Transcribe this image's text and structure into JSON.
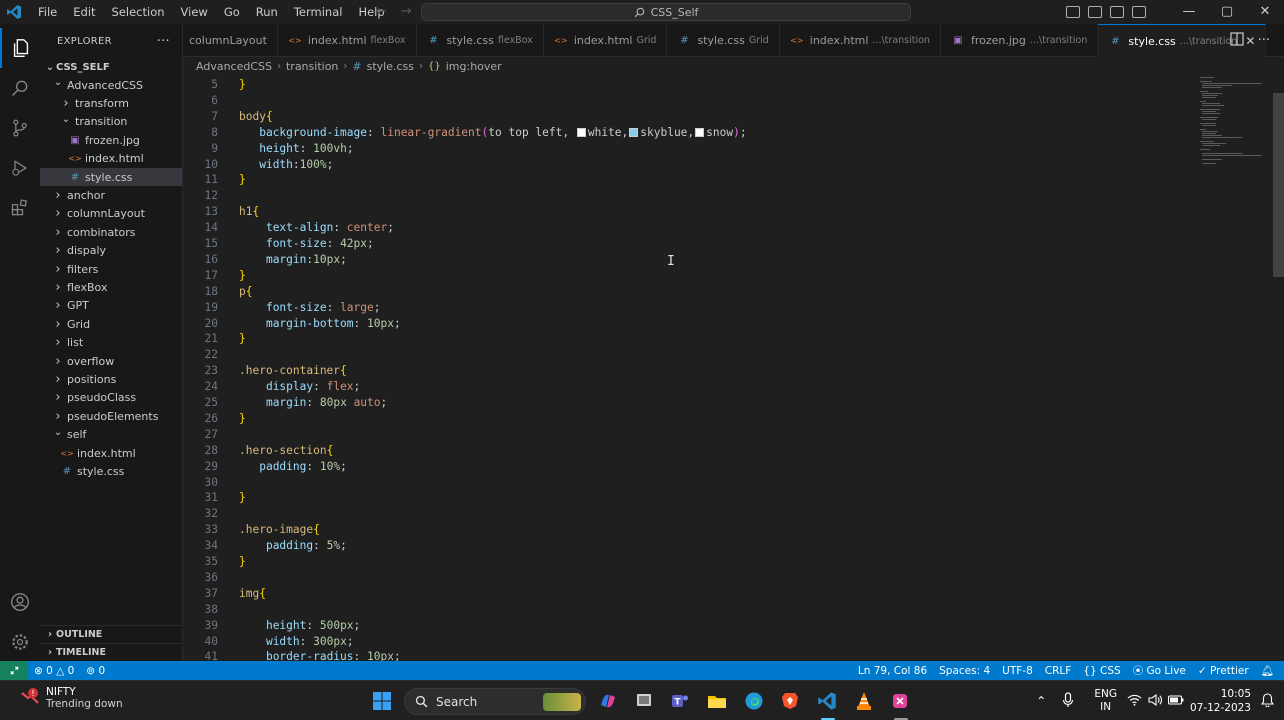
{
  "titlebar": {
    "menu": [
      "File",
      "Edit",
      "Selection",
      "View",
      "Go",
      "Run",
      "Terminal",
      "Help"
    ],
    "search_text": "CSS_Self",
    "minimize": "—",
    "maximize": "▢",
    "close": "✕"
  },
  "sidebar": {
    "header": "EXPLORER",
    "more": "···",
    "root": "CSS_SELF",
    "items": [
      {
        "label": "AdvancedCSS",
        "type": "folder-open",
        "indent": 1
      },
      {
        "label": "transform",
        "type": "folder",
        "indent": 2
      },
      {
        "label": "transition",
        "type": "folder-open",
        "indent": 2
      },
      {
        "label": "frozen.jpg",
        "type": "image",
        "indent": 3
      },
      {
        "label": "index.html",
        "type": "html",
        "indent": 3
      },
      {
        "label": "style.css",
        "type": "css",
        "indent": 3,
        "selected": true
      },
      {
        "label": "anchor",
        "type": "folder",
        "indent": 1
      },
      {
        "label": "columnLayout",
        "type": "folder",
        "indent": 1
      },
      {
        "label": "combinators",
        "type": "folder",
        "indent": 1
      },
      {
        "label": "dispaly",
        "type": "folder",
        "indent": 1
      },
      {
        "label": "filters",
        "type": "folder",
        "indent": 1
      },
      {
        "label": "flexBox",
        "type": "folder",
        "indent": 1
      },
      {
        "label": "GPT",
        "type": "folder",
        "indent": 1
      },
      {
        "label": "Grid",
        "type": "folder",
        "indent": 1
      },
      {
        "label": "list",
        "type": "folder",
        "indent": 1
      },
      {
        "label": "overflow",
        "type": "folder",
        "indent": 1
      },
      {
        "label": "positions",
        "type": "folder",
        "indent": 1
      },
      {
        "label": "pseudoClass",
        "type": "folder",
        "indent": 1
      },
      {
        "label": "pseudoElements",
        "type": "folder",
        "indent": 1
      },
      {
        "label": "self",
        "type": "folder-open",
        "indent": 1
      },
      {
        "label": "index.html",
        "type": "html",
        "indent": 2
      },
      {
        "label": "style.css",
        "type": "css",
        "indent": 2
      }
    ],
    "outline": "OUTLINE",
    "timeline": "TIMELINE"
  },
  "tabs": [
    {
      "label": "columnLayout",
      "desc": "",
      "type": "css-partial",
      "active": false
    },
    {
      "label": "index.html",
      "desc": "flexBox",
      "type": "html",
      "active": false
    },
    {
      "label": "style.css",
      "desc": "flexBox",
      "type": "css",
      "active": false
    },
    {
      "label": "index.html",
      "desc": "Grid",
      "type": "html",
      "active": false
    },
    {
      "label": "style.css",
      "desc": "Grid",
      "type": "css",
      "active": false
    },
    {
      "label": "index.html",
      "desc": "...\\transition",
      "type": "html",
      "active": false
    },
    {
      "label": "frozen.jpg",
      "desc": "...\\transition",
      "type": "image",
      "active": false
    },
    {
      "label": "style.css",
      "desc": "...\\transition",
      "type": "css",
      "active": true
    }
  ],
  "breadcrumb": [
    "AdvancedCSS",
    "transition",
    "style.css",
    "img:hover"
  ],
  "editor": {
    "lines": [
      {
        "n": "5",
        "code": [
          [
            "br",
            "}"
          ]
        ]
      },
      {
        "n": "6",
        "code": []
      },
      {
        "n": "7",
        "code": [
          [
            "sel",
            "body"
          ],
          [
            "br",
            "{"
          ]
        ]
      },
      {
        "n": "8",
        "code": [
          [
            "t",
            "   "
          ],
          [
            "prop",
            "background-image"
          ],
          [
            "t",
            ": "
          ],
          [
            "val",
            "linear-gradient"
          ],
          [
            "br2",
            "("
          ],
          [
            "t",
            "to top left, "
          ],
          [
            "sw",
            "#ffffff"
          ],
          [
            "t",
            "white,"
          ],
          [
            "sw",
            "#87ceeb"
          ],
          [
            "t",
            "skyblue,"
          ],
          [
            "sw",
            "#fffafa"
          ],
          [
            "t",
            "snow"
          ],
          [
            "br2",
            ")"
          ],
          [
            "t",
            ";"
          ]
        ]
      },
      {
        "n": "9",
        "code": [
          [
            "t",
            "   "
          ],
          [
            "prop",
            "height"
          ],
          [
            "t",
            ": "
          ],
          [
            "num",
            "100vh"
          ],
          [
            "t",
            ";"
          ]
        ]
      },
      {
        "n": "10",
        "code": [
          [
            "t",
            "   "
          ],
          [
            "prop",
            "width"
          ],
          [
            "t",
            ":"
          ],
          [
            "num",
            "100%"
          ],
          [
            "t",
            ";"
          ]
        ]
      },
      {
        "n": "11",
        "code": [
          [
            "br",
            "}"
          ]
        ]
      },
      {
        "n": "12",
        "code": []
      },
      {
        "n": "13",
        "code": [
          [
            "sel",
            "h1"
          ],
          [
            "br",
            "{"
          ]
        ]
      },
      {
        "n": "14",
        "code": [
          [
            "t",
            "    "
          ],
          [
            "prop",
            "text-align"
          ],
          [
            "t",
            ": "
          ],
          [
            "val",
            "center"
          ],
          [
            "t",
            ";"
          ]
        ]
      },
      {
        "n": "15",
        "code": [
          [
            "t",
            "    "
          ],
          [
            "prop",
            "font-size"
          ],
          [
            "t",
            ": "
          ],
          [
            "num",
            "42px"
          ],
          [
            "t",
            ";"
          ]
        ]
      },
      {
        "n": "16",
        "code": [
          [
            "t",
            "    "
          ],
          [
            "prop",
            "margin"
          ],
          [
            "t",
            ":"
          ],
          [
            "num",
            "10px"
          ],
          [
            "t",
            ";"
          ]
        ]
      },
      {
        "n": "17",
        "code": [
          [
            "br",
            "}"
          ]
        ]
      },
      {
        "n": "18",
        "code": [
          [
            "sel",
            "p"
          ],
          [
            "br",
            "{"
          ]
        ]
      },
      {
        "n": "19",
        "code": [
          [
            "t",
            "    "
          ],
          [
            "prop",
            "font-size"
          ],
          [
            "t",
            ": "
          ],
          [
            "val",
            "large"
          ],
          [
            "t",
            ";"
          ]
        ]
      },
      {
        "n": "20",
        "code": [
          [
            "t",
            "    "
          ],
          [
            "prop",
            "margin-bottom"
          ],
          [
            "t",
            ": "
          ],
          [
            "num",
            "10px"
          ],
          [
            "t",
            ";"
          ]
        ]
      },
      {
        "n": "21",
        "code": [
          [
            "br",
            "}"
          ]
        ]
      },
      {
        "n": "22",
        "code": []
      },
      {
        "n": "23",
        "code": [
          [
            "sel",
            ".hero-container"
          ],
          [
            "br",
            "{"
          ]
        ]
      },
      {
        "n": "24",
        "code": [
          [
            "t",
            "    "
          ],
          [
            "prop",
            "display"
          ],
          [
            "t",
            ": "
          ],
          [
            "val",
            "flex"
          ],
          [
            "t",
            ";"
          ]
        ]
      },
      {
        "n": "25",
        "code": [
          [
            "t",
            "    "
          ],
          [
            "prop",
            "margin"
          ],
          [
            "t",
            ": "
          ],
          [
            "num",
            "80px"
          ],
          [
            "t",
            " "
          ],
          [
            "val",
            "auto"
          ],
          [
            "t",
            ";"
          ]
        ]
      },
      {
        "n": "26",
        "code": [
          [
            "br",
            "}"
          ]
        ]
      },
      {
        "n": "27",
        "code": []
      },
      {
        "n": "28",
        "code": [
          [
            "sel",
            ".hero-section"
          ],
          [
            "br",
            "{"
          ]
        ]
      },
      {
        "n": "29",
        "code": [
          [
            "t",
            "   "
          ],
          [
            "prop",
            "padding"
          ],
          [
            "t",
            ": "
          ],
          [
            "num",
            "10%"
          ],
          [
            "t",
            ";"
          ]
        ]
      },
      {
        "n": "30",
        "code": []
      },
      {
        "n": "31",
        "code": [
          [
            "br",
            "}"
          ]
        ]
      },
      {
        "n": "32",
        "code": []
      },
      {
        "n": "33",
        "code": [
          [
            "sel",
            ".hero-image"
          ],
          [
            "br",
            "{"
          ]
        ]
      },
      {
        "n": "34",
        "code": [
          [
            "t",
            "    "
          ],
          [
            "prop",
            "padding"
          ],
          [
            "t",
            ": "
          ],
          [
            "num",
            "5%"
          ],
          [
            "t",
            ";"
          ]
        ]
      },
      {
        "n": "35",
        "code": [
          [
            "br",
            "}"
          ]
        ]
      },
      {
        "n": "36",
        "code": []
      },
      {
        "n": "37",
        "code": [
          [
            "sel",
            "img"
          ],
          [
            "br",
            "{"
          ]
        ]
      },
      {
        "n": "38",
        "code": []
      },
      {
        "n": "39",
        "code": [
          [
            "t",
            "    "
          ],
          [
            "prop",
            "height"
          ],
          [
            "t",
            ": "
          ],
          [
            "num",
            "500px"
          ],
          [
            "t",
            ";"
          ]
        ]
      },
      {
        "n": "40",
        "code": [
          [
            "t",
            "    "
          ],
          [
            "prop",
            "width"
          ],
          [
            "t",
            ": "
          ],
          [
            "num",
            "300px"
          ],
          [
            "t",
            ";"
          ]
        ]
      },
      {
        "n": "41",
        "code": [
          [
            "t",
            "    "
          ],
          [
            "prop",
            "border-radius"
          ],
          [
            "t",
            ": "
          ],
          [
            "num",
            "10px"
          ],
          [
            "t",
            ";"
          ]
        ]
      }
    ]
  },
  "statusbar": {
    "errors": "0",
    "warnings": "0",
    "ports": "0",
    "position": "Ln 79, Col 86",
    "spaces": "Spaces: 4",
    "encoding": "UTF-8",
    "eol": "CRLF",
    "language": "CSS",
    "golive": "Go Live",
    "prettier": "Prettier"
  },
  "taskbar": {
    "weather_title": "NIFTY",
    "weather_sub": "Trending down",
    "badge": "!",
    "search": "Search",
    "lang_top": "ENG",
    "lang_bottom": "IN",
    "time": "10:05",
    "date": "07-12-2023"
  },
  "colors": {
    "accent": "#007acc",
    "remote": "#16825d",
    "css_icon": "#519aba",
    "html_icon": "#e37933",
    "image_icon": "#a074c4"
  }
}
